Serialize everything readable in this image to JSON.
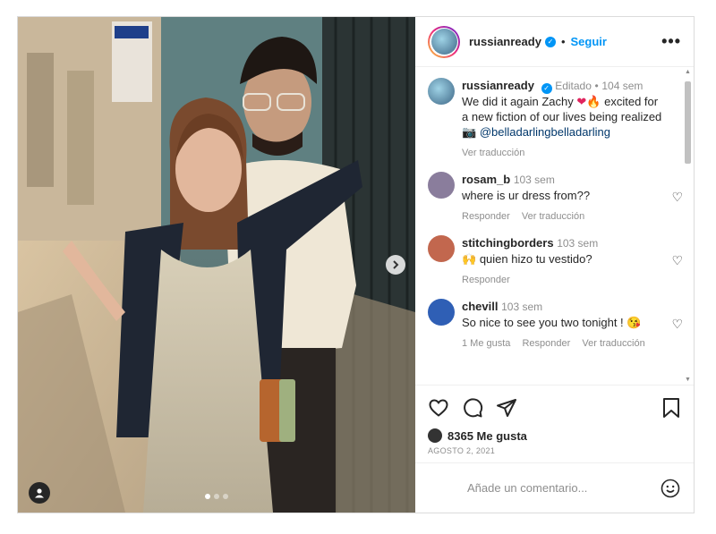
{
  "post": {
    "author": "russianready",
    "follow_label": "Seguir",
    "separator": "•",
    "more_label": "•••",
    "carousel_dots": 3,
    "active_dot": 0
  },
  "caption": {
    "author": "russianready",
    "edited": "Editado",
    "time": "104 sem",
    "text": "We did it again Zachy",
    "text2": "excited for a new fiction of our lives being realized",
    "mention": "@belladarlingbelladarling",
    "translate": "Ver traducción"
  },
  "comments": [
    {
      "user": "rosam_b",
      "time": "103 sem",
      "text": "where is ur dress from??",
      "actions": [
        "Responder",
        "Ver traducción"
      ],
      "avatar_color": "#8a7d9c"
    },
    {
      "user": "stitchingborders",
      "time": "103 sem",
      "text": "quien hizo tu vestido?",
      "actions": [
        "Responder"
      ],
      "avatar_color": "#c2674e"
    },
    {
      "user": "chevill",
      "time": "103 sem",
      "text": "So nice to see you two tonight !",
      "actions": [
        "1 Me gusta",
        "Responder",
        "Ver traducción"
      ],
      "avatar_color": "#2f5fb5"
    }
  ],
  "likes": {
    "count_label": "8365 Me gusta"
  },
  "date": "AGOSTO 2, 2021",
  "add_comment": {
    "placeholder": "Añade un comentario..."
  },
  "icons": {
    "like": "heart-icon",
    "comment": "comment-icon",
    "share": "share-icon",
    "save": "bookmark-icon",
    "emoji": "emoji-icon"
  },
  "colors": {
    "accent": "#0095f6",
    "text": "#262626",
    "muted": "#8e8e8e"
  }
}
